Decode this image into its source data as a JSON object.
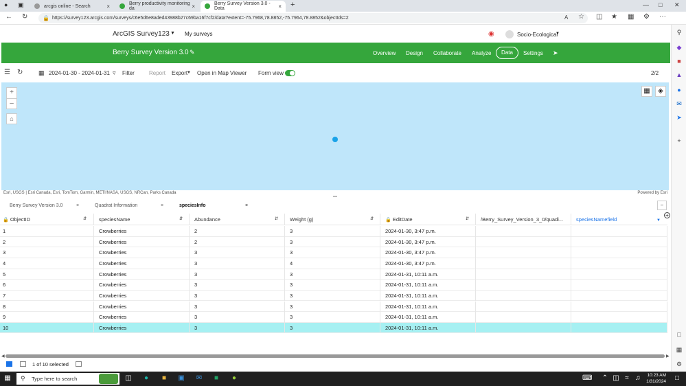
{
  "browser": {
    "tabs": [
      {
        "label": "arcgis online - Search",
        "icon": "search-icon"
      },
      {
        "label": "Berry productivity monitoring da",
        "icon": "survey123-icon"
      },
      {
        "label": "Berry Survey Version 3.0 - Data",
        "icon": "survey123-icon"
      }
    ],
    "url": "https://survey123.arcgis.com/surveys/c6e5d6e8aded43988b27c69ba16f7cf2/data?extent=-75.7968,78.8852,-75.7964,78.8852&objectIds=2"
  },
  "app": {
    "brand": "ArcGIS Survey123",
    "my_surveys": "My surveys",
    "user": "Socio-Ecological"
  },
  "survey_bar": {
    "title": "Berry Survey Version 3.0",
    "nav": [
      "Overview",
      "Design",
      "Collaborate",
      "Analyze",
      "Data",
      "Settings"
    ],
    "active": "Data",
    "accent": "#35a63c"
  },
  "toolbar": {
    "date_range": "2024-01-30 - 2024-01-31",
    "filter": "Filter",
    "report": "Report",
    "export": "Export",
    "open_map": "Open in Map Viewer",
    "form_view": "Form view",
    "record_counter": "2/2"
  },
  "map": {
    "attribution": "Esri, USGS | Esri Canada, Esri, TomTom, Garmin, METI/NASA, USGS, NRCan, Parks Canada",
    "powered_by": "Powered by Esri"
  },
  "table_tabs": [
    {
      "label": "Berry Survey Version 3.0"
    },
    {
      "label": "Quadrat Information"
    },
    {
      "label": "speciesInfo"
    }
  ],
  "table": {
    "columns": [
      "ObjectID",
      "speciesName",
      "Abundance",
      "Weight (g)",
      "EditDate",
      "/Berry_Survey_Version_3_0/quadi...",
      "speciesNamefield"
    ],
    "rows": [
      [
        "1",
        "Crowberries",
        "2",
        "3",
        "2024-01-30, 3:47 p.m.",
        "",
        ""
      ],
      [
        "2",
        "Crowberries",
        "2",
        "3",
        "2024-01-30, 3:47 p.m.",
        "",
        ""
      ],
      [
        "3",
        "Crowberries",
        "3",
        "3",
        "2024-01-30, 3:47 p.m.",
        "",
        ""
      ],
      [
        "4",
        "Crowberries",
        "3",
        "4",
        "2024-01-30, 3:47 p.m.",
        "",
        ""
      ],
      [
        "5",
        "Crowberries",
        "3",
        "3",
        "2024-01-31, 10:11 a.m.",
        "",
        ""
      ],
      [
        "6",
        "Crowberries",
        "3",
        "3",
        "2024-01-31, 10:11 a.m.",
        "",
        ""
      ],
      [
        "7",
        "Crowberries",
        "3",
        "3",
        "2024-01-31, 10:11 a.m.",
        "",
        ""
      ],
      [
        "8",
        "Crowberries",
        "3",
        "3",
        "2024-01-31, 10:11 a.m.",
        "",
        ""
      ],
      [
        "9",
        "Crowberries",
        "3",
        "3",
        "2024-01-31, 10:11 a.m.",
        "",
        ""
      ],
      [
        "10",
        "Crowberries",
        "3",
        "3",
        "2024-01-31, 10:11 a.m.",
        "",
        ""
      ]
    ],
    "selected_row": "10"
  },
  "footer": {
    "selection": "1 of 10 selected"
  },
  "taskbar": {
    "search_placeholder": "Type here to search",
    "time": "10:23 AM",
    "date": "1/31/2024"
  }
}
